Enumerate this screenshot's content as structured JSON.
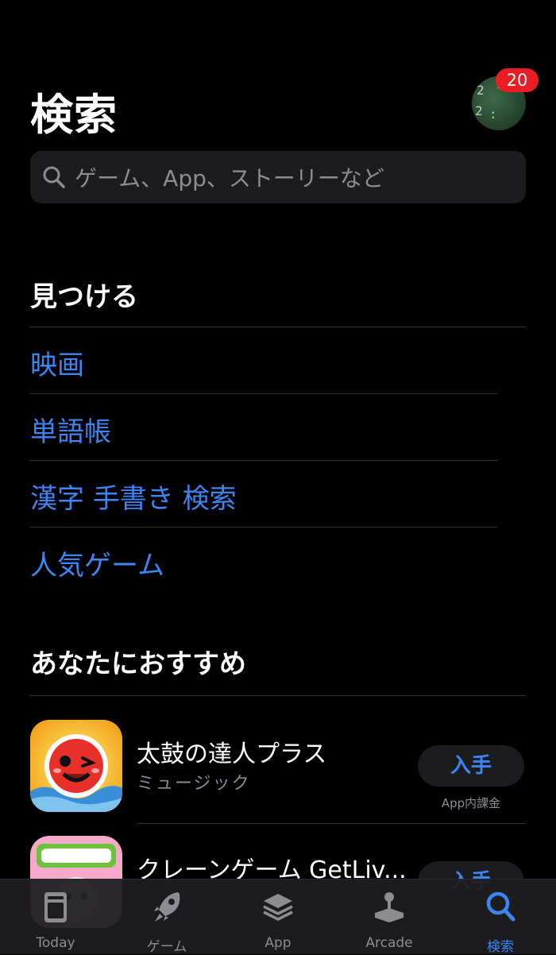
{
  "header": {
    "title": "検索",
    "badge_count": "20"
  },
  "search": {
    "placeholder": "ゲーム、App、ストーリーなど"
  },
  "discover": {
    "title": "見つける",
    "items": [
      "映画",
      "単語帳",
      "漢字 手書き 検索",
      "人気ゲーム"
    ]
  },
  "recommended": {
    "title": "あなたにおすすめ",
    "apps": [
      {
        "name": "太鼓の達人プラス",
        "category": "ミュージック",
        "button": "入手",
        "note": "App内課金"
      },
      {
        "name": "クレーンゲーム GetLiv...",
        "category": "",
        "button": "入手",
        "note": ""
      }
    ]
  },
  "tabbar": {
    "items": [
      {
        "label": "Today",
        "icon": "today-icon",
        "active": false
      },
      {
        "label": "ゲーム",
        "icon": "rocket-icon",
        "active": false
      },
      {
        "label": "App",
        "icon": "layers-icon",
        "active": false
      },
      {
        "label": "Arcade",
        "icon": "joystick-icon",
        "active": false
      },
      {
        "label": "検索",
        "icon": "search-icon",
        "active": true
      }
    ]
  },
  "colors": {
    "accent": "#3c85f2",
    "badge": "#ea1d24",
    "background": "#000000"
  }
}
